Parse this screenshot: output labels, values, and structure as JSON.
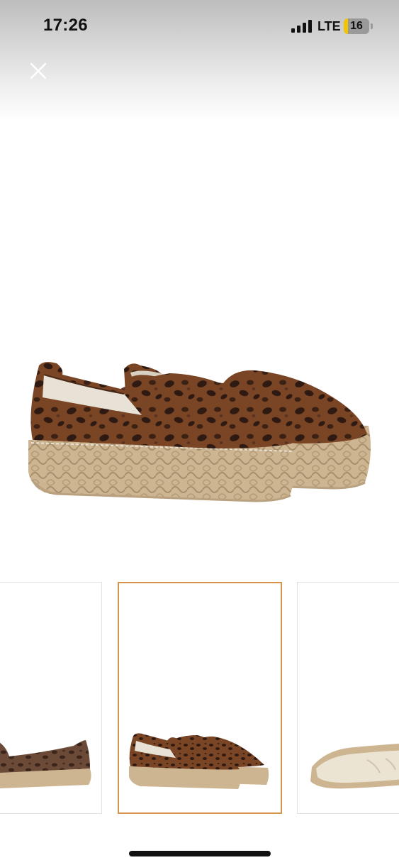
{
  "status_bar": {
    "time": "17:26",
    "network": "LTE",
    "battery_level": "16",
    "battery_fraction": 0.16,
    "signal_bars": 4,
    "icons": [
      "signal-icon",
      "battery-icon"
    ]
  },
  "header": {
    "close_icon": "close-icon"
  },
  "gallery": {
    "selected_index": 1,
    "thumbnails": [
      {
        "name": "thumbnail-side-view"
      },
      {
        "name": "thumbnail-pair-view"
      },
      {
        "name": "thumbnail-sole-view"
      }
    ]
  },
  "colors": {
    "selected_border": "#d8934a",
    "thumb_border": "#e2e2e2",
    "leopard_base": "#7a4524",
    "leopard_spots": "#2e1a12",
    "jute": "#cdb592"
  }
}
